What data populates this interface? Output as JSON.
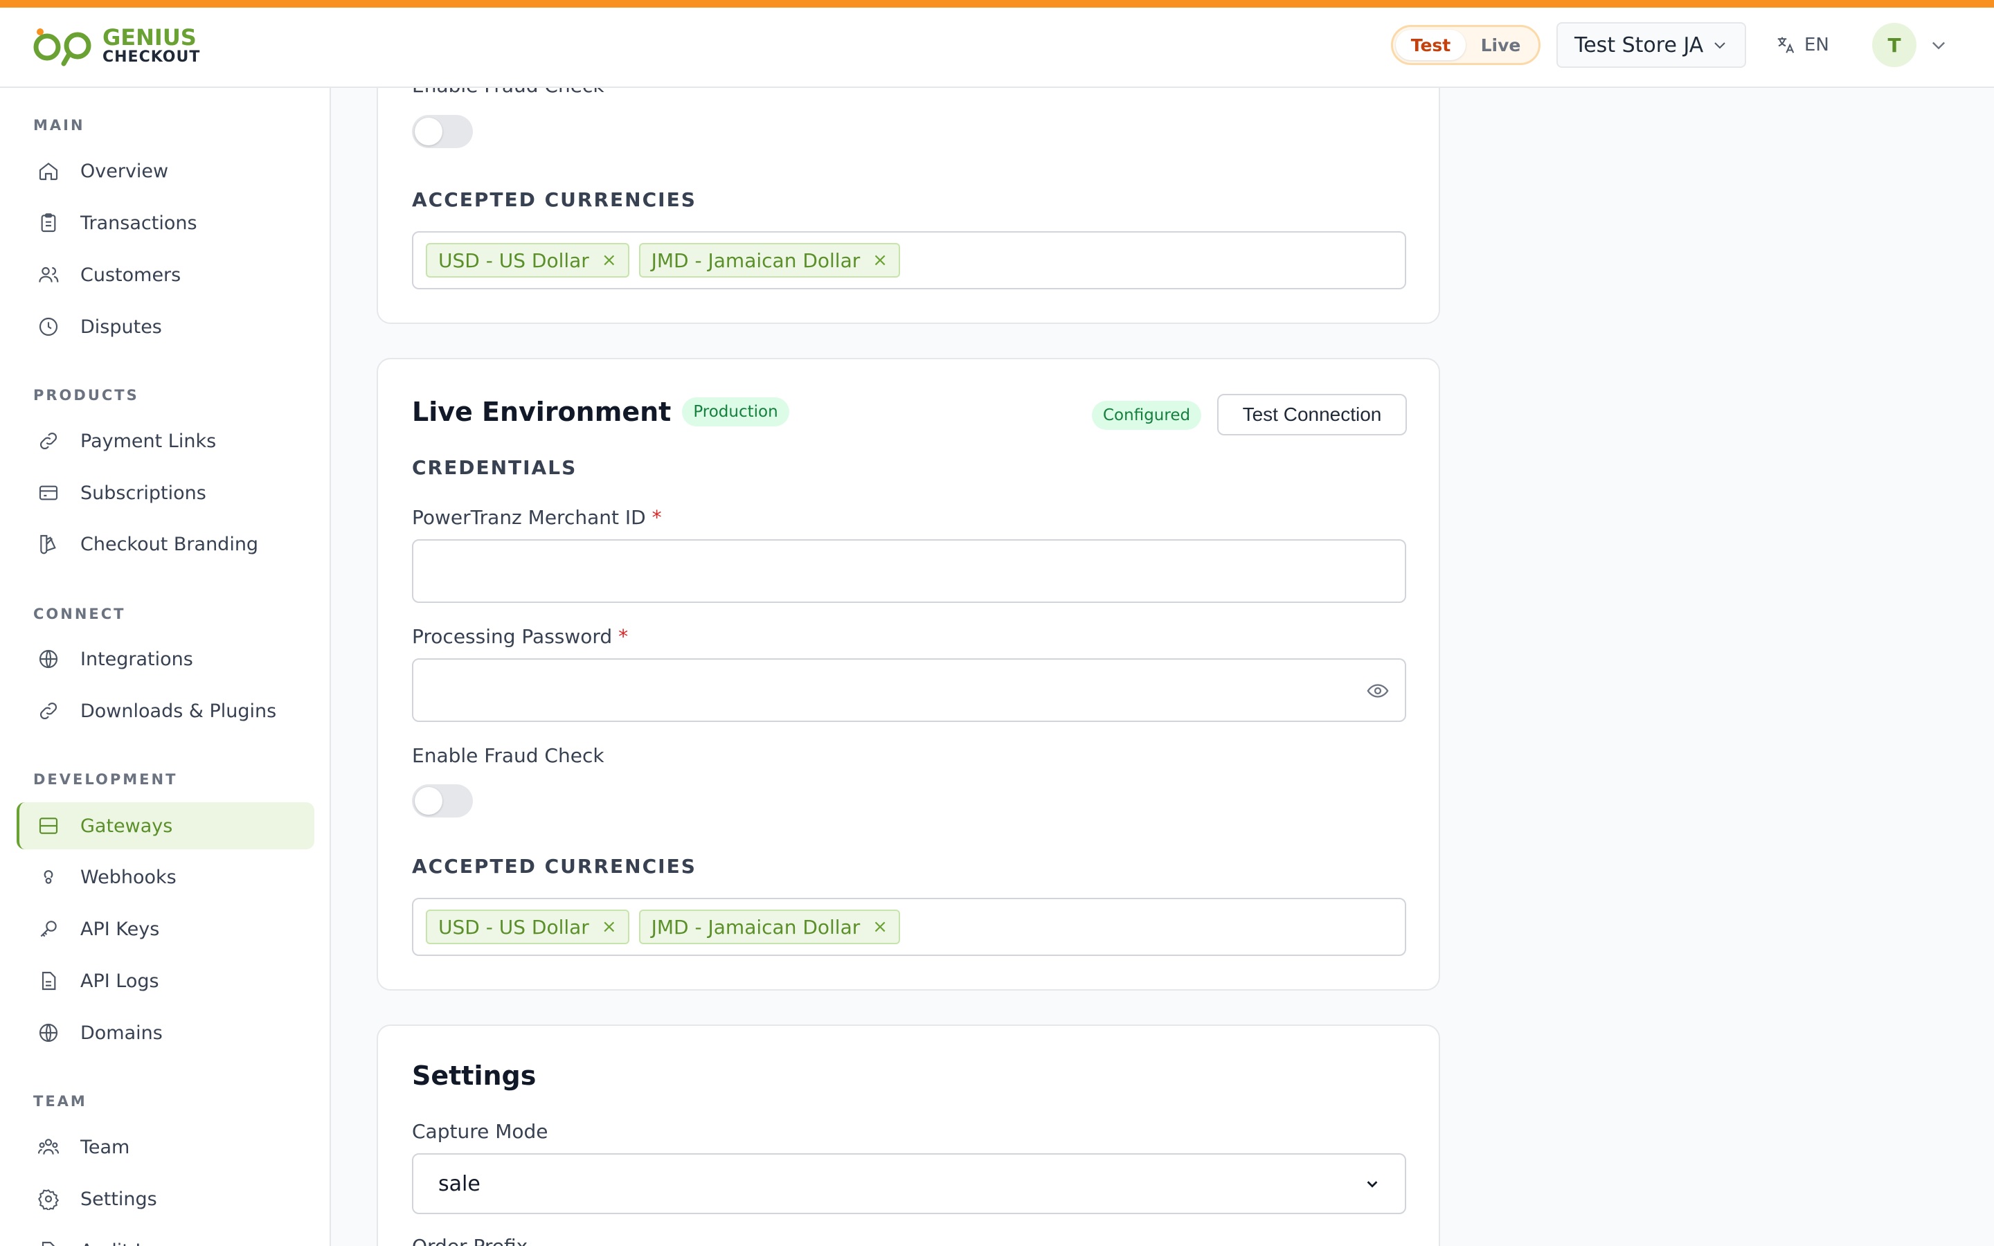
{
  "brand": {
    "line1": "GENIUS",
    "line2": "CHECKOUT"
  },
  "colors": {
    "accent": "#6aa133",
    "stripe": "#f7901e",
    "mode_active": "#c2410c"
  },
  "header": {
    "mode": {
      "test": "Test",
      "live": "Live",
      "selected": "Test"
    },
    "store": "Test Store JA",
    "language": "EN",
    "avatar_initial": "T"
  },
  "sidebar": {
    "sections": [
      {
        "title": "MAIN",
        "items": [
          {
            "label": "Overview",
            "icon": "home-icon"
          },
          {
            "label": "Transactions",
            "icon": "clipboard-icon"
          },
          {
            "label": "Customers",
            "icon": "users-icon"
          },
          {
            "label": "Disputes",
            "icon": "clock-icon"
          }
        ]
      },
      {
        "title": "PRODUCTS",
        "items": [
          {
            "label": "Payment Links",
            "icon": "link-icon"
          },
          {
            "label": "Subscriptions",
            "icon": "card-icon"
          },
          {
            "label": "Checkout Branding",
            "icon": "palette-icon"
          }
        ]
      },
      {
        "title": "CONNECT",
        "items": [
          {
            "label": "Integrations",
            "icon": "globe-icon"
          },
          {
            "label": "Downloads & Plugins",
            "icon": "link-icon"
          }
        ]
      },
      {
        "title": "DEVELOPMENT",
        "items": [
          {
            "label": "Gateways",
            "icon": "server-icon",
            "active": true
          },
          {
            "label": "Webhooks",
            "icon": "webhook-icon"
          },
          {
            "label": "API Keys",
            "icon": "key-icon"
          },
          {
            "label": "API Logs",
            "icon": "file-icon"
          },
          {
            "label": "Domains",
            "icon": "globe-icon"
          }
        ]
      },
      {
        "title": "TEAM",
        "items": [
          {
            "label": "Team",
            "icon": "team-icon"
          },
          {
            "label": "Settings",
            "icon": "gear-icon"
          },
          {
            "label": "Audit Log",
            "icon": "file-icon"
          }
        ]
      }
    ]
  },
  "test_env": {
    "fraud_label": "Enable Fraud Check",
    "fraud_enabled": false,
    "currencies_heading": "ACCEPTED CURRENCIES",
    "currencies": [
      "USD - US Dollar",
      "JMD - Jamaican Dollar"
    ],
    "remove_glyph": "×"
  },
  "live_env": {
    "title": "Live Environment",
    "badge": "Production",
    "status": "Configured",
    "test_button": "Test Connection",
    "credentials_heading": "CREDENTIALS",
    "merchant_label": "PowerTranz Merchant ID",
    "password_label": "Processing Password",
    "required_mark": "*",
    "merchant_value": "",
    "password_value": "",
    "fraud_label": "Enable Fraud Check",
    "fraud_enabled": false,
    "currencies_heading": "ACCEPTED CURRENCIES",
    "currencies": [
      "USD - US Dollar",
      "JMD - Jamaican Dollar"
    ],
    "remove_glyph": "×"
  },
  "settings": {
    "title": "Settings",
    "capture_label": "Capture Mode",
    "capture_value": "sale",
    "order_prefix_label": "Order Prefix"
  }
}
